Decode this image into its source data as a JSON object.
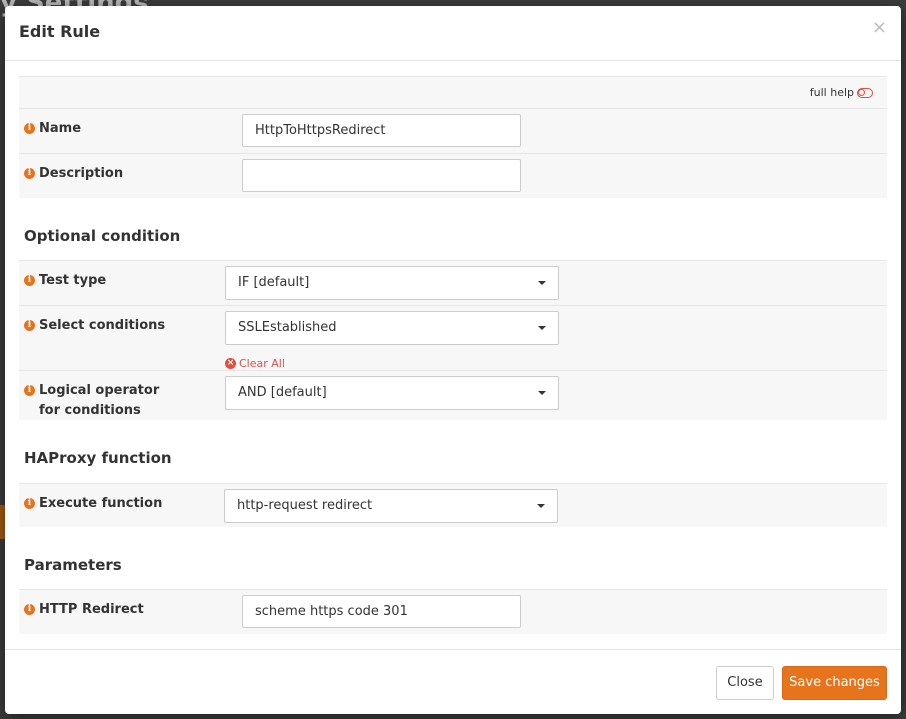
{
  "background": {
    "title_fragment": "y Settings"
  },
  "modal": {
    "title": "Edit Rule",
    "close_glyph": "×",
    "full_help": "full help",
    "fields": {
      "name": {
        "label": "Name",
        "value": "HttpToHttpsRedirect"
      },
      "description": {
        "label": "Description",
        "value": ""
      }
    },
    "optional_condition": {
      "heading": "Optional condition",
      "test_type": {
        "label": "Test type",
        "value": "IF [default]"
      },
      "select_conditions": {
        "label": "Select conditions",
        "value": "SSLEstablished",
        "clear_all": "Clear All"
      },
      "logical_operator": {
        "label": "Logical operator for conditions",
        "value": "AND [default]"
      }
    },
    "haproxy_function": {
      "heading": "HAProxy function",
      "execute_function": {
        "label": "Execute function",
        "value": "http-request redirect"
      }
    },
    "parameters": {
      "heading": "Parameters",
      "http_redirect": {
        "label": "HTTP Redirect",
        "value": "scheme https code 301"
      }
    },
    "footer": {
      "close_label": "Close",
      "save_label": "Save changes"
    }
  },
  "colors": {
    "accent": "#e8731d",
    "danger": "#e74c3c",
    "row_bg": "#f7f7f7"
  },
  "icons": [
    "info-icon",
    "toggle-icon",
    "clear-icon",
    "close-icon",
    "chevron-down-icon"
  ]
}
